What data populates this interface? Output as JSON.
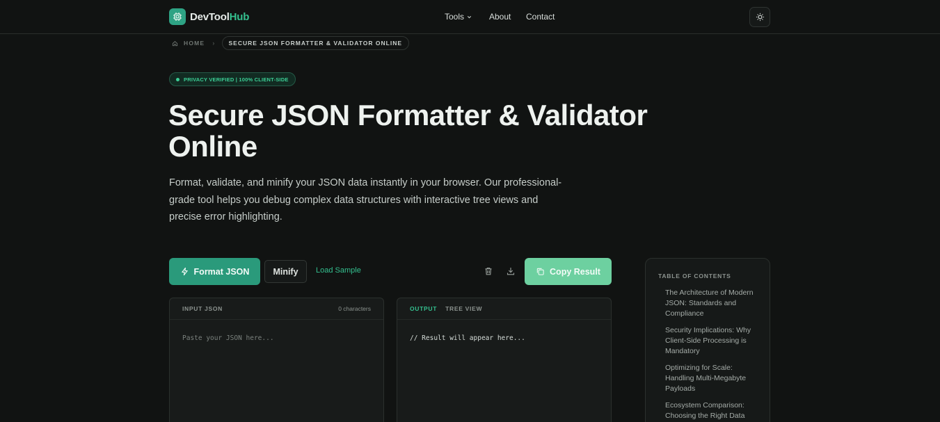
{
  "header": {
    "brand_primary": "DevTool",
    "brand_accent": "Hub",
    "nav": {
      "tools": "Tools",
      "about": "About",
      "contact": "Contact"
    }
  },
  "breadcrumb": {
    "home": "HOME",
    "separator": "›",
    "current": "SECURE JSON FORMATTER & VALIDATOR ONLINE"
  },
  "badge": "PRIVACY VERIFIED | 100% CLIENT-SIDE",
  "hero": {
    "title": "Secure JSON Formatter & Validator Online",
    "lead": "Format, validate, and minify your JSON data instantly in your browser. Our professional-grade tool helps you debug complex data structures with interactive tree views and precise error highlighting."
  },
  "toolbar": {
    "format_label": "Format JSON",
    "minify_label": "Minify",
    "sample_label": "Load Sample",
    "copy_label": "Copy Result"
  },
  "input_panel": {
    "label": "INPUT JSON",
    "char_count": "0 characters",
    "placeholder": "Paste your JSON here..."
  },
  "output_panel": {
    "tab_output": "OUTPUT",
    "tab_tree": "TREE VIEW",
    "placeholder": "// Result will appear here..."
  },
  "toc": {
    "title": "TABLE OF CONTENTS",
    "items": [
      "The Architecture of Modern JSON: Standards and Compliance",
      "Security Implications: Why Client-Side Processing is Mandatory",
      "Optimizing for Scale: Handling Multi-Megabyte Payloads",
      "Ecosystem Comparison: Choosing the Right Data"
    ]
  },
  "colors": {
    "background": "#111312",
    "accent": "#2a9a7b",
    "accent_text": "#34c08f",
    "copy_button": "#6dd0a0"
  },
  "icons": {
    "logo": "chip-icon",
    "theme": "sun-icon",
    "format": "lightning-icon",
    "clear": "trash-icon",
    "download": "download-icon",
    "copy": "copy-icon"
  }
}
